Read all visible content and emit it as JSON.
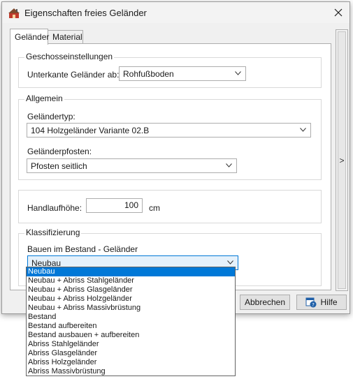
{
  "window": {
    "title": "Eigenschaften freies Geländer"
  },
  "tabs": [
    {
      "label": "Geländer"
    },
    {
      "label": "Material"
    }
  ],
  "geschoss": {
    "group_label": "Geschosseinstellungen",
    "unterkante_label": "Unterkante Geländer ab:",
    "unterkante_value": "Rohfußboden"
  },
  "allgemein": {
    "group_label": "Allgemein",
    "typ_label": "Geländertyp:",
    "typ_value": "104 Holzgeländer Variante 02.B",
    "pfosten_label": "Geländerpfosten:",
    "pfosten_value": "Pfosten seitlich"
  },
  "handlauf": {
    "label": "Handlaufhöhe:",
    "value": "100",
    "unit": "cm"
  },
  "klass": {
    "group_label": "Klassifizierung",
    "sub_label": "Bauen im Bestand - Geländer",
    "value": "Neubau",
    "options": [
      "Neubau",
      "Neubau  + Abriss  Stahlgeländer",
      "Neubau  + Abriss  Glasgeländer",
      "Neubau  + Abriss  Holzgeländer",
      "Neubau  + Abriss Massivbrüstung",
      "Bestand",
      "Bestand aufbereiten",
      "Bestand ausbauen  + aufbereiten",
      "Abriss Stahlgeländer",
      "Abriss Glasgeländer",
      "Abriss Holzgeländer",
      "Abriss Massivbrüstung"
    ]
  },
  "side_arrow": ">",
  "buttons": {
    "cancel": "Abbrechen",
    "help": "Hilfe"
  },
  "colors": {
    "accent": "#0078d7",
    "selection_text": "#ffffff"
  }
}
